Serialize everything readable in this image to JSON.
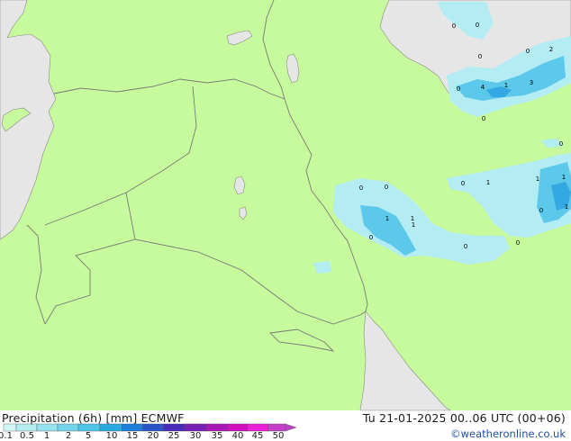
{
  "title": "Precipitation (6h) [mm] ECMWF",
  "validity": "Tu 21-01-2025 00..06 UTC (00+06)",
  "credit": "©weatheronline.co.uk",
  "legend": {
    "labels": [
      "0.1",
      "0.5",
      "1",
      "2",
      "5",
      "10",
      "15",
      "20",
      "25",
      "30",
      "35",
      "40",
      "45",
      "50"
    ],
    "colors": [
      "#d2f5f6",
      "#b4ecf2",
      "#96e2ee",
      "#72d4ea",
      "#4ec4e6",
      "#2aa8e0",
      "#1e7ed8",
      "#2a54c8",
      "#4a2ab8",
      "#7620b4",
      "#a818b4",
      "#d010c0",
      "#ec20d8",
      "#c040c8"
    ]
  },
  "colors": {
    "land": "#c6fa9c",
    "sea": "#e6e6e6",
    "border": "#7a7a7a",
    "precip_light": "#b4ecf4",
    "precip_medium": "#5cc8ea",
    "precip_heavy": "#34a8e2"
  },
  "value_labels": [
    "0",
    "0",
    "0",
    "0",
    "4",
    "1",
    "3",
    "0",
    "0",
    "2",
    "0",
    "0",
    "0",
    "0",
    "1",
    "1",
    "1",
    "1",
    "1",
    "0",
    "0",
    "0",
    "1",
    "1",
    "0"
  ]
}
